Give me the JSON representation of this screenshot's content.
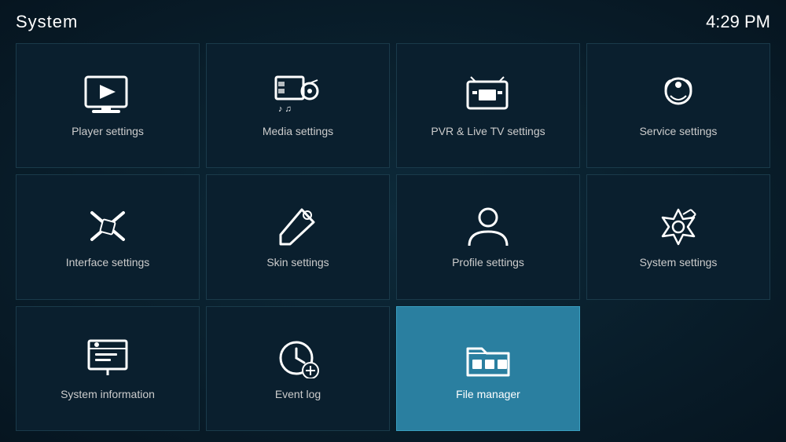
{
  "header": {
    "title": "System",
    "time": "4:29 PM"
  },
  "tiles": [
    {
      "id": "player-settings",
      "label": "Player settings",
      "icon": "player",
      "active": false
    },
    {
      "id": "media-settings",
      "label": "Media settings",
      "icon": "media",
      "active": false
    },
    {
      "id": "pvr-settings",
      "label": "PVR & Live TV settings",
      "icon": "pvr",
      "active": false
    },
    {
      "id": "service-settings",
      "label": "Service settings",
      "icon": "service",
      "active": false
    },
    {
      "id": "interface-settings",
      "label": "Interface settings",
      "icon": "interface",
      "active": false
    },
    {
      "id": "skin-settings",
      "label": "Skin settings",
      "icon": "skin",
      "active": false
    },
    {
      "id": "profile-settings",
      "label": "Profile settings",
      "icon": "profile",
      "active": false
    },
    {
      "id": "system-settings",
      "label": "System settings",
      "icon": "system",
      "active": false
    },
    {
      "id": "system-information",
      "label": "System information",
      "icon": "info",
      "active": false
    },
    {
      "id": "event-log",
      "label": "Event log",
      "icon": "eventlog",
      "active": false
    },
    {
      "id": "file-manager",
      "label": "File manager",
      "icon": "files",
      "active": true
    }
  ]
}
